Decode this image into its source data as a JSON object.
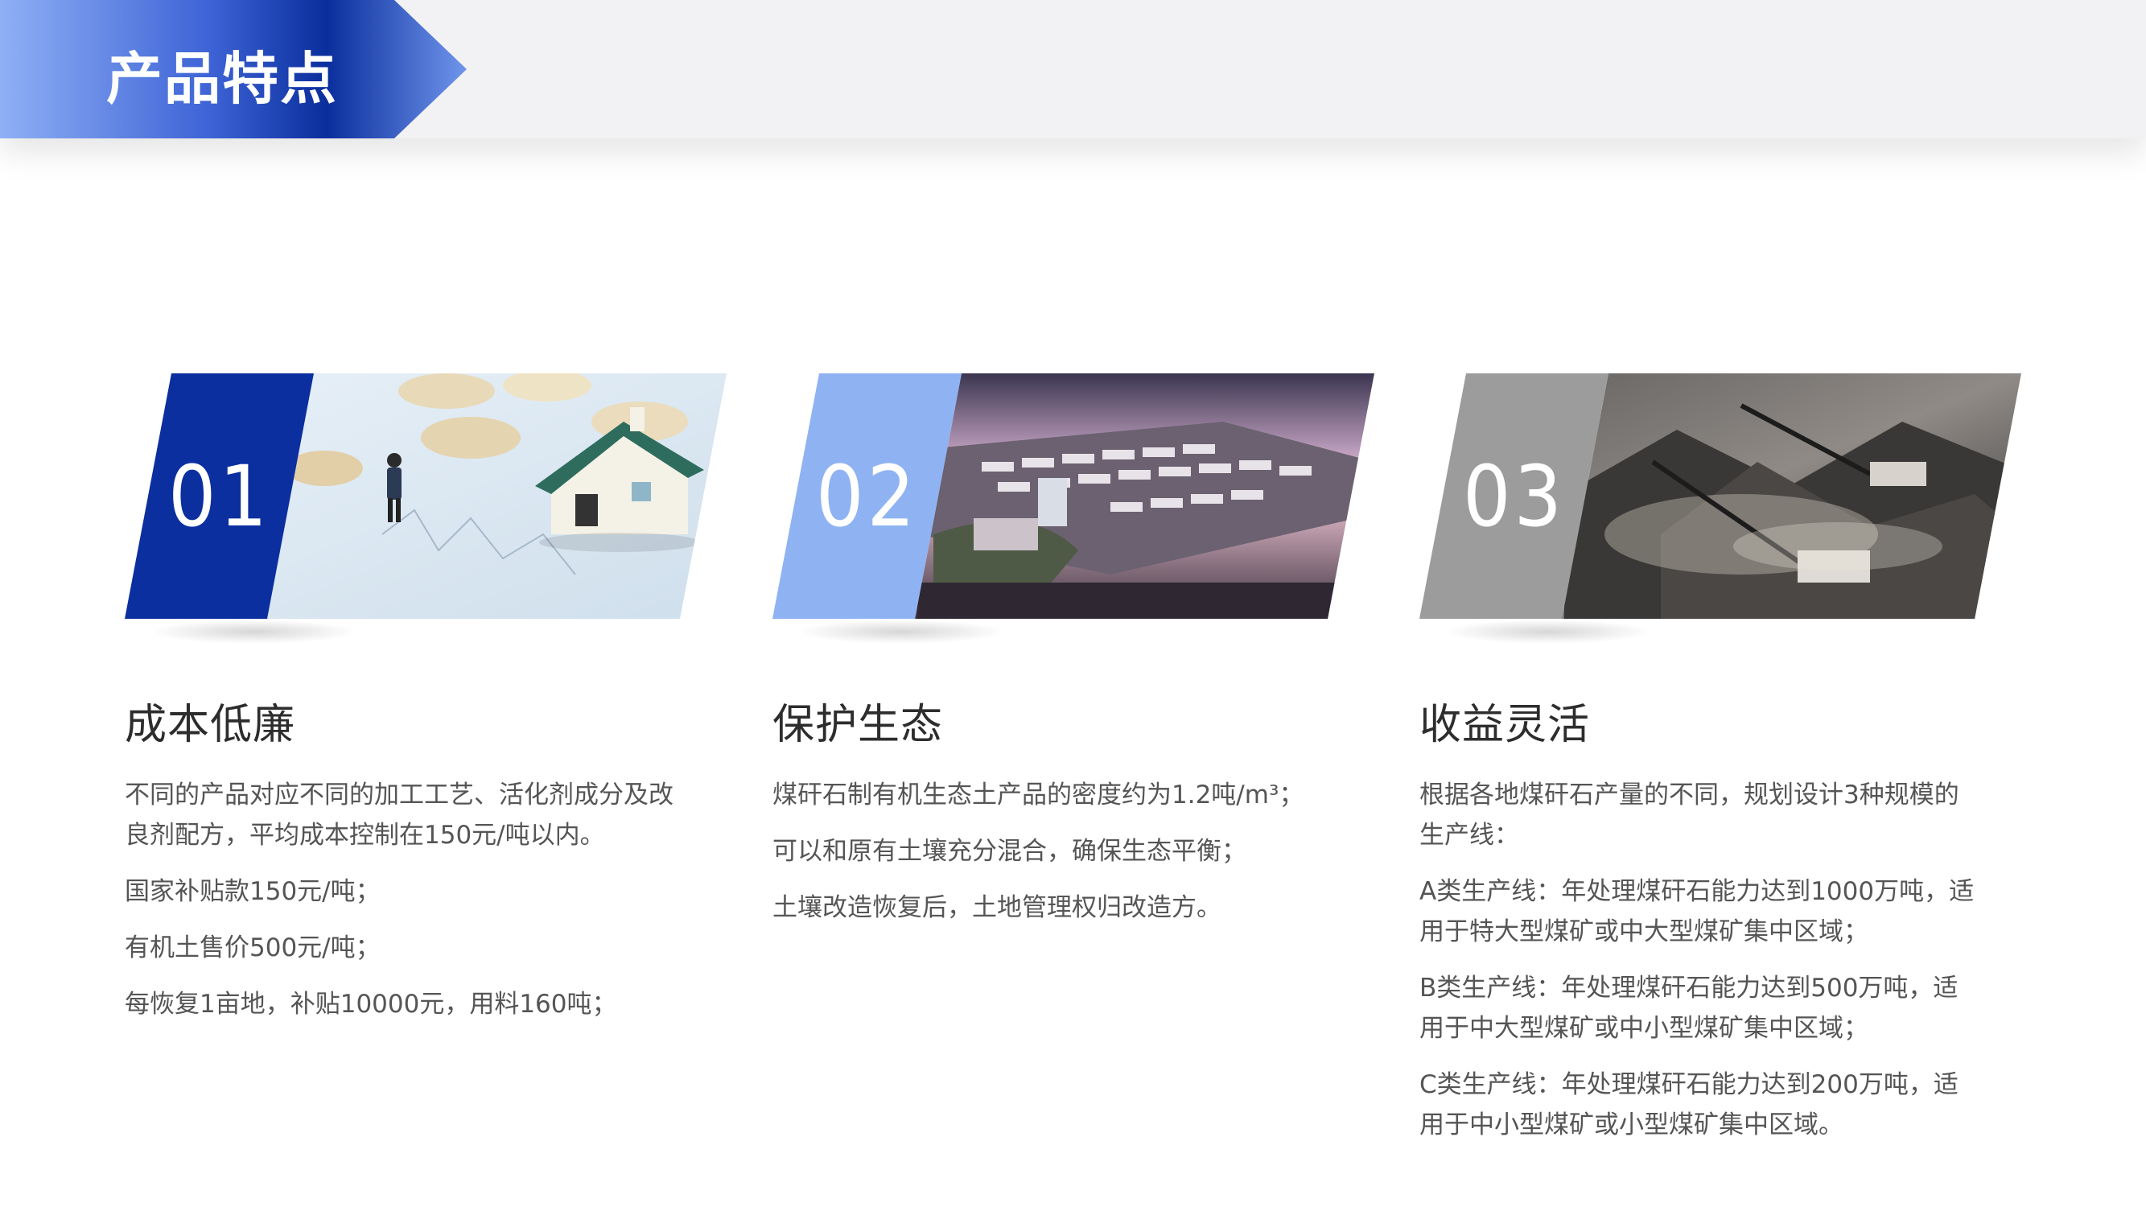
{
  "header": {
    "title": "产品特点"
  },
  "cards": [
    {
      "number": "01",
      "heading": "成本低廉",
      "image": "house-figure-coins-photo",
      "accent": "#0b2f9f",
      "paragraphs": [
        "不同的产品对应不同的加工工艺、活化剂成分及改良剂配方，平均成本控制在150元/吨以内。",
        "国家补贴款150元/吨；",
        "有机土售价500元/吨；",
        "每恢复1亩地，补贴10000元，用料160吨；"
      ]
    },
    {
      "number": "02",
      "heading": "保护生态",
      "image": "industrial-park-aerial-photo",
      "accent": "#8fb3f2",
      "paragraphs": [
        "煤矸石制有机生态土产品的密度约为1.2吨/m³；",
        "可以和原有土壤充分混合，确保生态平衡；",
        "土壤改造恢复后，土地管理权归改造方。"
      ]
    },
    {
      "number": "03",
      "heading": "收益灵活",
      "image": "mining-excavator-photo",
      "accent": "#9c9c9c",
      "paragraphs": [
        "根据各地煤矸石产量的不同，规划设计3种规模的生产线：",
        "A类生产线：年处理煤矸石能力达到1000万吨，适用于特大型煤矿或中大型煤矿集中区域；",
        "B类生产线：年处理煤矸石能力达到500万吨，适用于中大型煤矿或中小型煤矿集中区域；",
        "C类生产线：年处理煤矸石能力达到200万吨，适用于中小型煤矿或小型煤矿集中区域。"
      ]
    }
  ]
}
